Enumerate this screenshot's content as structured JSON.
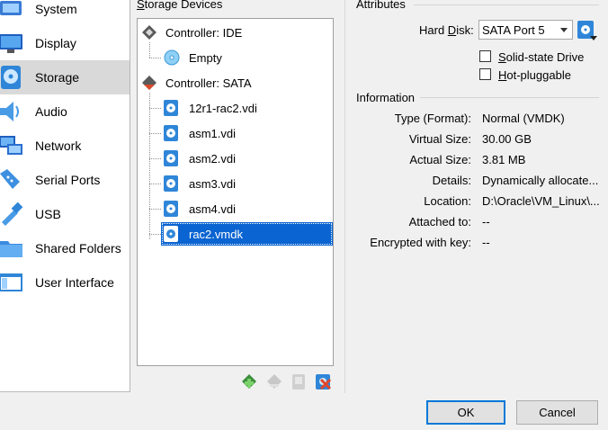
{
  "sidebar": {
    "items": [
      {
        "label": "System",
        "icon": "system-icon"
      },
      {
        "label": "Display",
        "icon": "display-icon"
      },
      {
        "label": "Storage",
        "icon": "storage-icon"
      },
      {
        "label": "Audio",
        "icon": "audio-icon"
      },
      {
        "label": "Network",
        "icon": "network-icon"
      },
      {
        "label": "Serial Ports",
        "icon": "serial-ports-icon"
      },
      {
        "label": "USB",
        "icon": "usb-icon"
      },
      {
        "label": "Shared Folders",
        "icon": "shared-folders-icon"
      },
      {
        "label": "User Interface",
        "icon": "user-interface-icon"
      }
    ],
    "selected": "Storage"
  },
  "storage_devices": {
    "title_first": "S",
    "title_rest": "torage Devices",
    "controllers": [
      {
        "label": "Controller: IDE",
        "children": [
          "Empty"
        ]
      },
      {
        "label": "Controller: SATA",
        "children": [
          "12r1-rac2.vdi",
          "asm1.vdi",
          "asm2.vdi",
          "asm3.vdi",
          "asm4.vdi",
          "rac2.vmdk"
        ]
      }
    ],
    "selected": "rac2.vmdk"
  },
  "attributes": {
    "title": "Attributes",
    "hard_disk_label_pre": "Hard ",
    "hard_disk_label_u": "D",
    "hard_disk_label_post": "isk:",
    "hard_disk_value": "SATA Port 5",
    "ssd_u": "S",
    "ssd_rest": "olid-state Drive",
    "hotplug_u": "H",
    "hotplug_rest": "ot-pluggable",
    "ssd_checked": false,
    "hotplug_checked": false
  },
  "information": {
    "title": "Information",
    "rows": [
      {
        "key": "Type (Format):",
        "value": "Normal (VMDK)"
      },
      {
        "key": "Virtual Size:",
        "value": "30.00 GB"
      },
      {
        "key": "Actual Size:",
        "value": "3.81 MB"
      },
      {
        "key": "Details:",
        "value": "Dynamically allocate..."
      },
      {
        "key": "Location:",
        "value": "D:\\Oracle\\VM_Linux\\..."
      },
      {
        "key": "Attached to:",
        "value": "--"
      },
      {
        "key": "Encrypted with key:",
        "value": "--"
      }
    ]
  },
  "buttons": {
    "ok": "OK",
    "cancel": "Cancel"
  },
  "colors": {
    "selection": "#0a64d1",
    "accent": "#0078d7"
  }
}
